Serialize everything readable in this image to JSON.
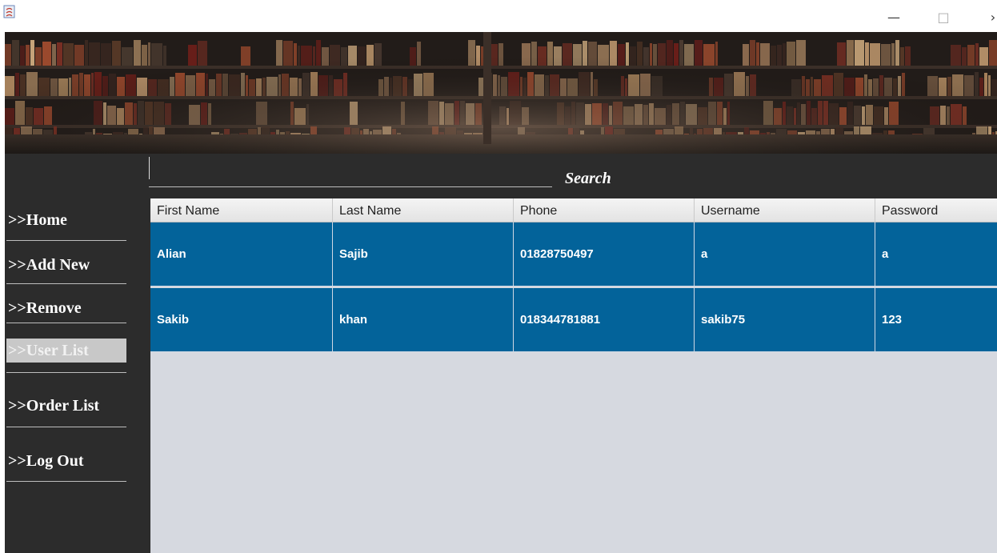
{
  "window": {
    "minimize_glyph": "—",
    "maximize_glyph": "□",
    "close_glyph": "›"
  },
  "sidebar": {
    "items": [
      {
        "label": ">>Home",
        "active": false
      },
      {
        "label": ">>Add New",
        "active": false
      },
      {
        "label": ">>Remove",
        "active": false
      },
      {
        "label": ">>User List",
        "active": true
      },
      {
        "label": ">>Order List",
        "active": false
      },
      {
        "label": ">>Log Out",
        "active": false
      }
    ]
  },
  "search": {
    "label": "Search",
    "value": ""
  },
  "table": {
    "columns": [
      "First Name",
      "Last Name",
      "Phone",
      "Username",
      "Password"
    ],
    "rows": [
      [
        "Alian",
        "Sajib",
        "01828750497",
        "a",
        "a"
      ],
      [
        "Sakib",
        "khan",
        "018344781881",
        "sakib75",
        "123"
      ]
    ]
  },
  "colors": {
    "selected_row": "#03639a",
    "panel_bg": "#2c2c2c",
    "table_bg": "#d6d9e0"
  }
}
